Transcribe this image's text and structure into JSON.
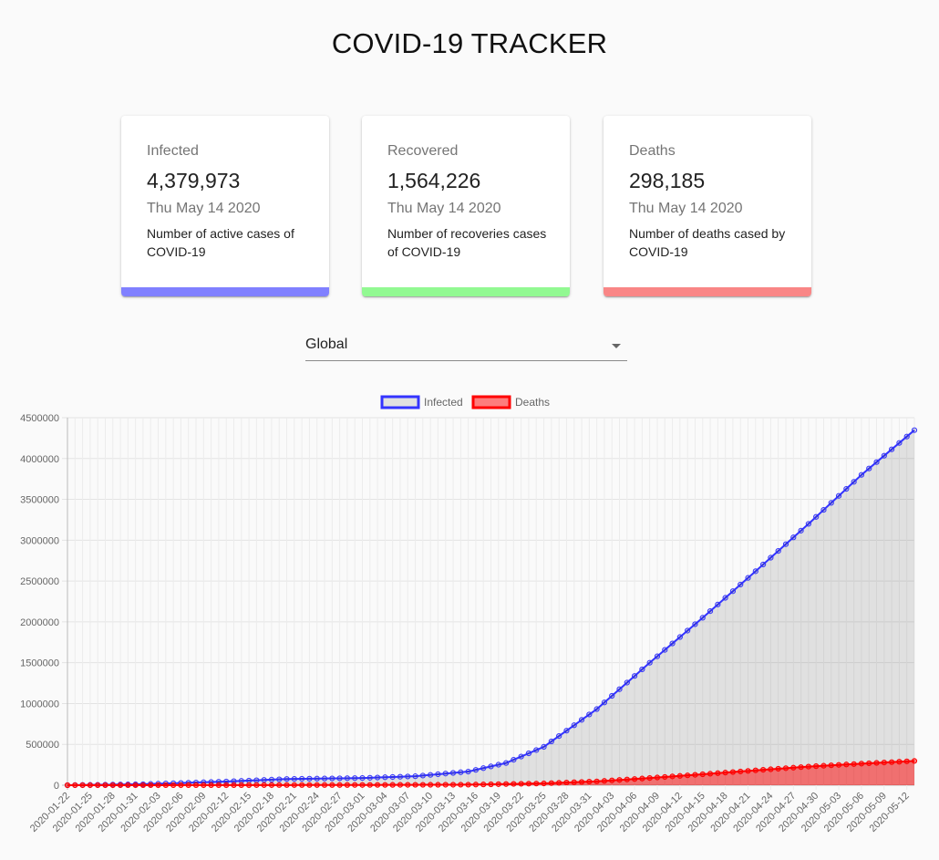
{
  "header": {
    "title": "COVID-19 TRACKER"
  },
  "cards": [
    {
      "title": "Infected",
      "value": "4,379,973",
      "date": "Thu May 14 2020",
      "description": "Number of active cases of COVID-19",
      "color": "#8080ff"
    },
    {
      "title": "Recovered",
      "value": "1,564,226",
      "date": "Thu May 14 2020",
      "description": "Number of recoveries cases of COVID-19",
      "color": "#92f992"
    },
    {
      "title": "Deaths",
      "value": "298,185",
      "date": "Thu May 14 2020",
      "description": "Number of deaths cased by COVID-19",
      "color": "#f98686"
    }
  ],
  "country_select": {
    "selected": "Global"
  },
  "chart_data": {
    "type": "line",
    "title": "",
    "legend": {
      "placement": "top-center"
    },
    "grid": true,
    "ylim": [
      0,
      4500000
    ],
    "yticks": [
      0,
      500000,
      1000000,
      1500000,
      2000000,
      2500000,
      3000000,
      3500000,
      4000000,
      4500000
    ],
    "x_start": "2020-01-22",
    "x_end": "2020-05-13",
    "x_tick_labels": [
      "2020-01-22",
      "2020-01-25",
      "2020-01-28",
      "2020-01-31",
      "2020-02-03",
      "2020-02-06",
      "2020-02-09",
      "2020-02-12",
      "2020-02-15",
      "2020-02-18",
      "2020-02-21",
      "2020-02-24",
      "2020-02-27",
      "2020-03-01",
      "2020-03-04",
      "2020-03-07",
      "2020-03-10",
      "2020-03-13",
      "2020-03-16",
      "2020-03-19",
      "2020-03-22",
      "2020-03-25",
      "2020-03-28",
      "2020-03-31",
      "2020-04-03",
      "2020-04-06",
      "2020-04-09",
      "2020-04-12",
      "2020-04-15",
      "2020-04-18",
      "2020-04-21",
      "2020-04-24",
      "2020-04-27",
      "2020-04-30",
      "2020-05-03",
      "2020-05-06",
      "2020-05-09",
      "2020-05-12"
    ],
    "series": [
      {
        "name": "Infected",
        "color": "#3333ff",
        "fill": "rgba(0,0,0,0.1)",
        "anchors": [
          [
            "2020-01-22",
            555
          ],
          [
            "2020-02-01",
            12000
          ],
          [
            "2020-02-12",
            45000
          ],
          [
            "2020-02-20",
            76000
          ],
          [
            "2020-03-01",
            88000
          ],
          [
            "2020-03-08",
            110000
          ],
          [
            "2020-03-15",
            167000
          ],
          [
            "2020-03-20",
            272000
          ],
          [
            "2020-03-25",
            470000
          ],
          [
            "2020-04-01",
            932000
          ],
          [
            "2020-04-08",
            1500000
          ],
          [
            "2020-04-15",
            2050000
          ],
          [
            "2020-04-22",
            2620000
          ],
          [
            "2020-04-29",
            3200000
          ],
          [
            "2020-05-06",
            3800000
          ],
          [
            "2020-05-13",
            4347000
          ]
        ]
      },
      {
        "name": "Deaths",
        "color": "#ff0000",
        "fill": "rgba(255,0,0,0.5)",
        "anchors": [
          [
            "2020-01-22",
            17
          ],
          [
            "2020-02-12",
            1100
          ],
          [
            "2020-03-01",
            3000
          ],
          [
            "2020-03-15",
            6500
          ],
          [
            "2020-03-25",
            22000
          ],
          [
            "2020-04-01",
            47000
          ],
          [
            "2020-04-08",
            88000
          ],
          [
            "2020-04-15",
            134000
          ],
          [
            "2020-04-22",
            182000
          ],
          [
            "2020-04-29",
            228000
          ],
          [
            "2020-05-06",
            264000
          ],
          [
            "2020-05-13",
            297000
          ]
        ]
      }
    ]
  }
}
